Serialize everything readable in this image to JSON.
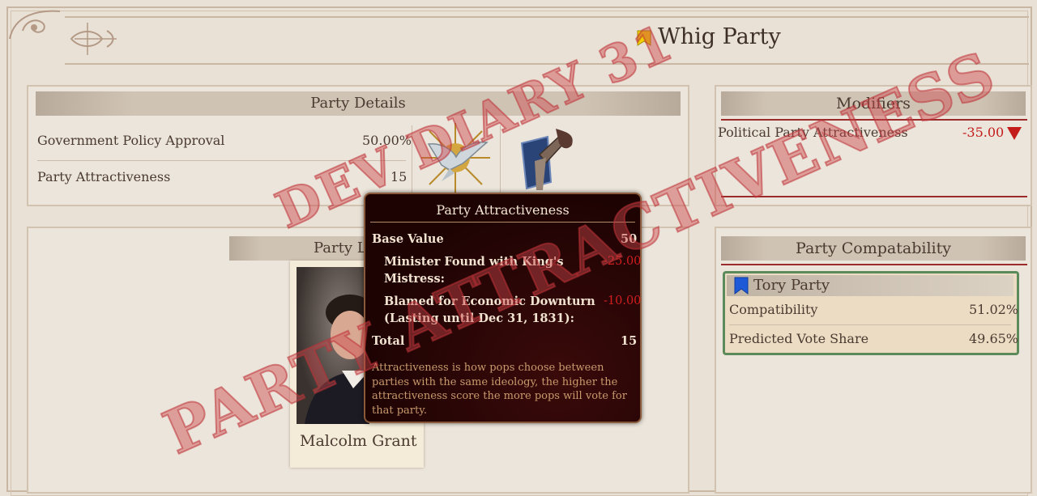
{
  "party": {
    "name": "Whig Party"
  },
  "details": {
    "header": "Party Details",
    "rows": [
      {
        "label": "Government Policy Approval",
        "value": "50.00%"
      },
      {
        "label": "Party Attractiveness",
        "value": "15"
      }
    ]
  },
  "leader_panel": {
    "header": "Party L",
    "leader_name": "Malcolm Grant"
  },
  "modifiers": {
    "header": "Modifiers",
    "items": [
      {
        "label": "Political  Party  Attractiveness",
        "value": "-35.00"
      }
    ]
  },
  "compat": {
    "header": "Party Compatability",
    "card": {
      "party": "Tory Party",
      "rows": [
        {
          "label": "Compatibility",
          "value": "51.02%"
        },
        {
          "label": "Predicted Vote Share",
          "value": "49.65%"
        }
      ]
    }
  },
  "tooltip": {
    "title": "Party Attractiveness",
    "base_label": "Base Value",
    "base_value": "50",
    "mod1_label_l1": "Minister Found with King's",
    "mod1_label_l2": "Mistress:",
    "mod1_value": "-25.00",
    "mod2_label_l1": "Blamed for Economic Downturn",
    "mod2_label_l2": "(Lasting until Dec 31, 1831):",
    "mod2_value": "-10.00",
    "total_label": "Total",
    "total_value": "15",
    "desc_l1": "Attractiveness is how pops choose between",
    "desc_l2": "parties with the same ideology, the higher the",
    "desc_l3": "attractiveness score the more pops will vote for",
    "desc_l4": "that party."
  },
  "watermark": {
    "line1": "DEV DIARY 31",
    "line2": "PARTY ATTRACTIVENESS"
  },
  "colors": {
    "whig_flag": "#f0d000",
    "tory_flag": "#1e5ad8",
    "negative": "#c41b1b",
    "card_border": "#5b8a5b"
  }
}
